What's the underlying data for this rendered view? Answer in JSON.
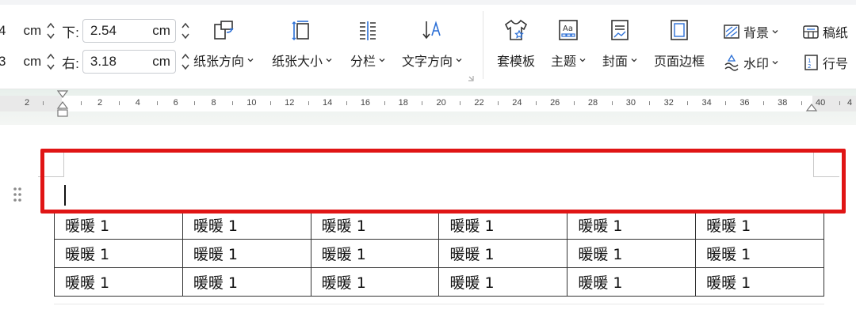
{
  "margins": {
    "row1": {
      "partial_value": "4",
      "unit": "cm",
      "label": "下:",
      "value": "2.54",
      "value_unit": "cm"
    },
    "row2": {
      "partial_value": "3",
      "unit": "cm",
      "label": "右:",
      "value": "3.18",
      "value_unit": "cm"
    }
  },
  "tools": {
    "orientation": "纸张方向",
    "size": "纸张大小",
    "columns": "分栏",
    "text_direction": "文字方向",
    "template": "套模板",
    "theme": "主题",
    "cover": "封面",
    "page_border": "页面边框",
    "background": "背景",
    "watermark": "水印",
    "manuscript": "稿纸",
    "line_number": "行号"
  },
  "ruler": {
    "labels": [
      "2",
      "2",
      "4",
      "6",
      "8",
      "10",
      "12",
      "14",
      "16",
      "18",
      "20",
      "22",
      "24",
      "26",
      "28",
      "30",
      "32",
      "34",
      "36",
      "38",
      "40",
      "4"
    ]
  },
  "table": {
    "rows": [
      [
        "暖暖 1",
        "暖暖 1",
        "暖暖 1",
        "暖暖 1",
        "暖暖 1",
        "暖暖 1"
      ],
      [
        "暖暖 1",
        "暖暖 1",
        "暖暖 1",
        "暖暖 1",
        "暖暖 1",
        "暖暖 1"
      ],
      [
        "暖暖 1",
        "暖暖 1",
        "暖暖 1",
        "暖暖 1",
        "暖暖 1",
        "暖暖 1"
      ]
    ]
  },
  "colors": {
    "highlight": "#e01515",
    "ribbon_icon": "#333333",
    "accent": "#2b6fd6"
  }
}
